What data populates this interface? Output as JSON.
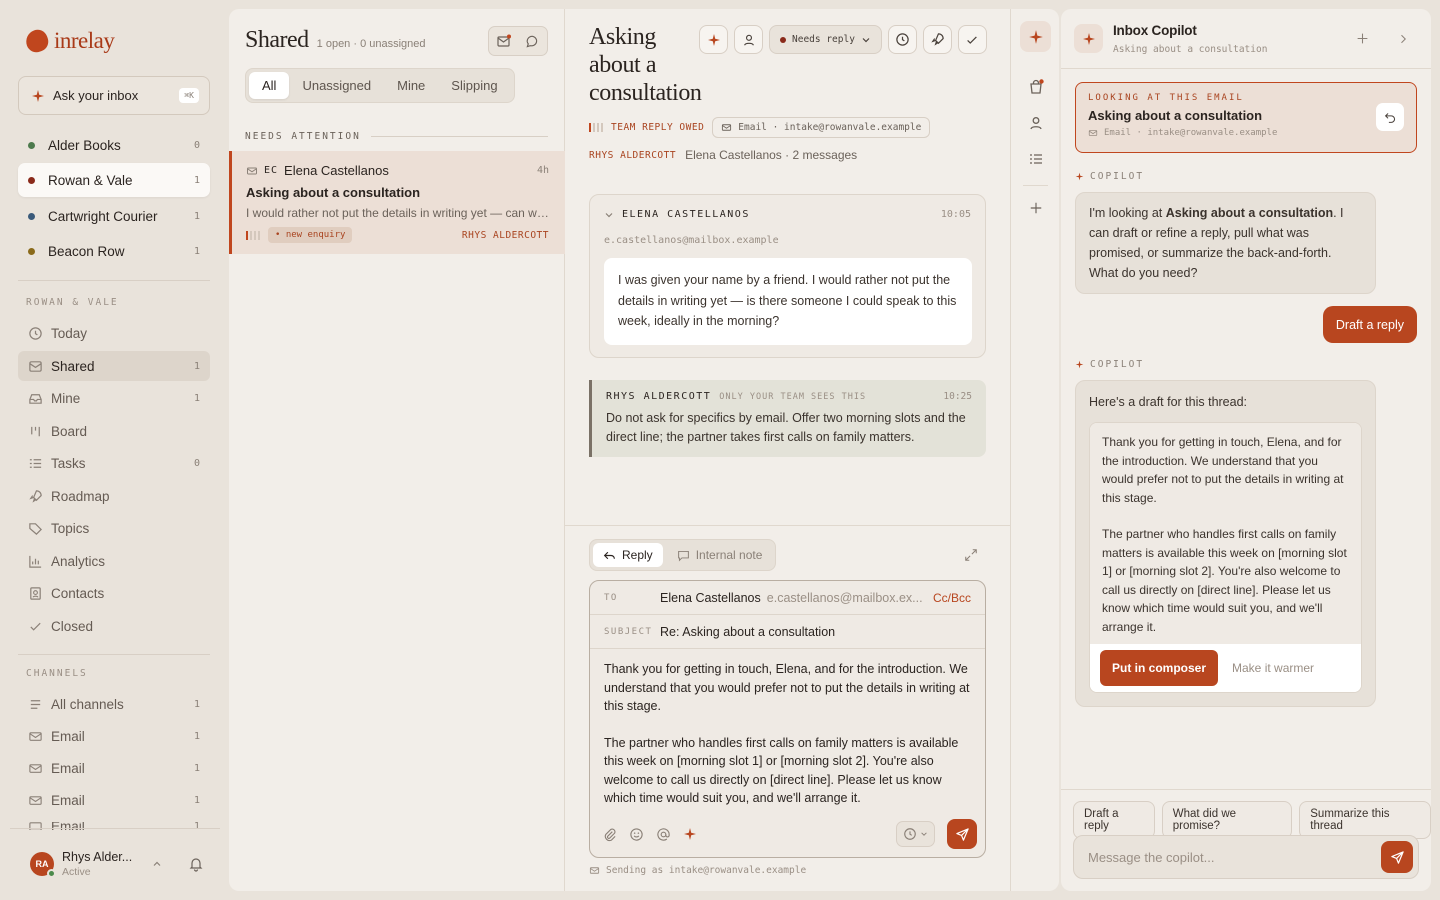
{
  "app": {
    "name": "inrelay",
    "ask_label": "Ask your inbox",
    "ask_kbd": "⌘K"
  },
  "workspaces": [
    {
      "name": "Alder Books",
      "count": "0",
      "color": "#4d7a4d"
    },
    {
      "name": "Rowan & Vale",
      "count": "1",
      "color": "#8a2a1a"
    },
    {
      "name": "Cartwright Courier",
      "count": "1",
      "color": "#3a5a7a"
    },
    {
      "name": "Beacon Row",
      "count": "1",
      "color": "#8a6a1a"
    }
  ],
  "nav_section": "ROWAN & VALE",
  "nav": [
    {
      "label": "Today",
      "count": ""
    },
    {
      "label": "Shared",
      "count": "1"
    },
    {
      "label": "Mine",
      "count": "1"
    },
    {
      "label": "Board",
      "count": ""
    },
    {
      "label": "Tasks",
      "count": "0"
    },
    {
      "label": "Roadmap",
      "count": ""
    },
    {
      "label": "Topics",
      "count": ""
    },
    {
      "label": "Analytics",
      "count": ""
    },
    {
      "label": "Contacts",
      "count": ""
    },
    {
      "label": "Closed",
      "count": ""
    }
  ],
  "channels_section": "CHANNELS",
  "channels": [
    {
      "label": "All channels",
      "count": "1"
    },
    {
      "label": "Email",
      "count": "1"
    },
    {
      "label": "Email",
      "count": "1"
    },
    {
      "label": "Email",
      "count": "1"
    },
    {
      "label": "Email",
      "count": "1"
    }
  ],
  "user": {
    "initials": "RA",
    "name": "Rhys Alder...",
    "status": "Active"
  },
  "list": {
    "title": "Shared",
    "subtitle": "1 open · 0 unassigned",
    "filters": [
      "All",
      "Unassigned",
      "Mine",
      "Slipping"
    ],
    "section": "NEEDS ATTENTION",
    "items": [
      {
        "initials": "EC",
        "name": "Elena Castellanos",
        "time": "4h",
        "subject": "Asking about a consultation",
        "preview": "I would rather not put the details in writing yet — can we speak to someone this week?",
        "tag": "• new enquiry",
        "assignee": "RHYS ALDERCOTT"
      }
    ]
  },
  "thread": {
    "title": "Asking about a consultation",
    "status": "Needs reply",
    "team_label": "TEAM REPLY OWED",
    "channel": "Email · intake@rowanvale.example",
    "assignee": "RHYS ALDERCOTT",
    "contact_meta": "Elena Castellanos · 2 messages",
    "message": {
      "sender": "ELENA CASTELLANOS",
      "time": "10:05",
      "email": "e.castellanos@mailbox.example",
      "body": "I was given your name by a friend. I would rather not put the details in writing yet — is there someone I could speak to this week, ideally in the morning?"
    },
    "note": {
      "author": "RHYS ALDERCOTT",
      "visibility": "ONLY YOUR TEAM SEES THIS",
      "time": "10:25",
      "body": "Do not ask for specifics by email. Offer two morning slots and the direct line; the partner takes first calls on family matters."
    }
  },
  "composer": {
    "tab_reply": "Reply",
    "tab_note": "Internal note",
    "to_label": "TO",
    "to_name": "Elena Castellanos",
    "to_email": "e.castellanos@mailbox.ex...",
    "ccbcc": "Cc/Bcc",
    "subject_label": "SUBJECT",
    "subject": "Re: Asking about a consultation",
    "body_p1": "Thank you for getting in touch, Elena, and for the introduction. We understand that you would prefer not to put the details in writing at this stage.",
    "body_p2": "The partner who handles first calls on family matters is available this week on [morning slot 1] or [morning slot 2]. You're also welcome to call us directly on [direct line]. Please let us know which time would suit you, and we'll arrange it.",
    "sending_as": "Sending as intake@rowanvale.example"
  },
  "copilot": {
    "title": "Inbox Copilot",
    "subtitle": "Asking about a consultation",
    "looking_label": "LOOKING AT THIS EMAIL",
    "looking_title": "Asking about a consultation",
    "looking_channel": "Email · intake@rowanvale.example",
    "label": "COPILOT",
    "intro_pre": "I'm looking at ",
    "intro_bold": "Asking about a consultation",
    "intro_post": ". I can draft or refine a reply, pull what was promised, or summarize the back-and-forth. What do you need?",
    "user_msg": "Draft a reply",
    "draft_intro": "Here's a draft for this thread:",
    "draft_p1": "Thank you for getting in touch, Elena, and for the introduction. We understand that you would prefer not to put the details in writing at this stage.",
    "draft_p2": "The partner who handles first calls on family matters is available this week on [morning slot 1] or [morning slot 2]. You're also welcome to call us directly on [direct line]. Please let us know which time would suit you, and we'll arrange it.",
    "put_btn": "Put in composer",
    "warmer_btn": "Make it warmer",
    "chips": [
      "Draft a reply",
      "What did we promise?",
      "Summarize this thread"
    ],
    "input_placeholder": "Message the copilot..."
  }
}
